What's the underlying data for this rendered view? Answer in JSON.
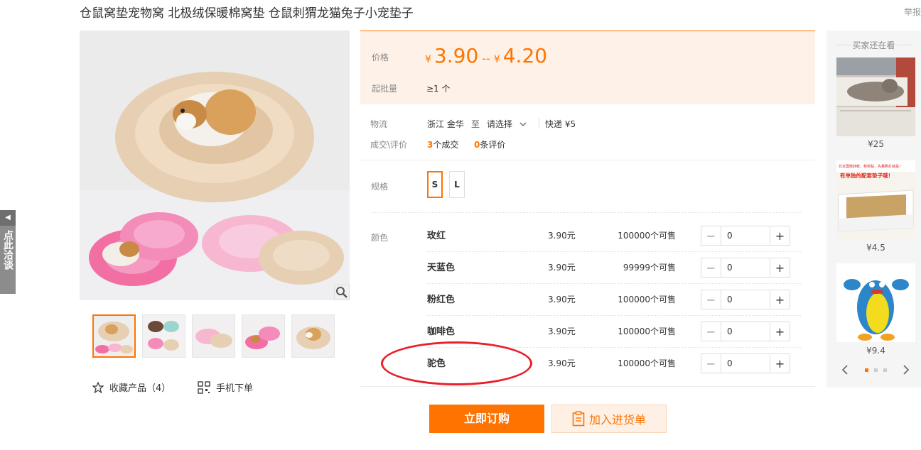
{
  "header": {
    "title": "仓鼠窝垫宠物窝 北极绒保暖棉窝垫 仓鼠刺猬龙猫兔子小宠垫子",
    "report": "举报"
  },
  "chat_tab": {
    "label": "点此洽谈"
  },
  "gallery": {
    "favorite_label": "收藏产品（4）",
    "mobile_order_label": "手机下单"
  },
  "price": {
    "label": "价格",
    "currency": "¥",
    "low": "3.90",
    "separator": "--",
    "high": "4.20",
    "moq_label": "起批量",
    "moq_value": "≥1 个"
  },
  "logistics": {
    "label": "物流",
    "origin": "浙江 金华",
    "to": "至",
    "destination": "请选择",
    "express": "快递 ¥5"
  },
  "deals": {
    "label": "成交\\评价",
    "deal_count": "3",
    "deal_text": "个成交",
    "review_count": "0",
    "review_text": "条评价"
  },
  "spec": {
    "label": "规格",
    "options": [
      "S",
      "L"
    ],
    "selected": "S"
  },
  "colors": {
    "label": "颜色",
    "rows": [
      {
        "name": "玫红",
        "price": "3.90元",
        "stock": "100000个可售",
        "qty": "0"
      },
      {
        "name": "天蓝色",
        "price": "3.90元",
        "stock": "99999个可售",
        "qty": "0"
      },
      {
        "name": "粉红色",
        "price": "3.90元",
        "stock": "100000个可售",
        "qty": "0"
      },
      {
        "name": "咖啡色",
        "price": "3.90元",
        "stock": "100000个可售",
        "qty": "0"
      },
      {
        "name": "驼色",
        "price": "3.90元",
        "stock": "100000个可售",
        "qty": "0"
      }
    ]
  },
  "actions": {
    "buy_now": "立即订购",
    "add_to_list": "加入进货单"
  },
  "rail": {
    "title": "买家还在看",
    "items": [
      {
        "price": "¥25"
      },
      {
        "price": "¥4.5",
        "banner": "日本国熊转帐，称奖贴，先量刷打就是！",
        "headline": "有单独的配套垫子哦！"
      },
      {
        "price": "¥9.4"
      }
    ]
  },
  "colors_theme": {
    "accent": "#ff7300",
    "price_bg": "#fdf1e8",
    "annotation": "#e8202a"
  }
}
